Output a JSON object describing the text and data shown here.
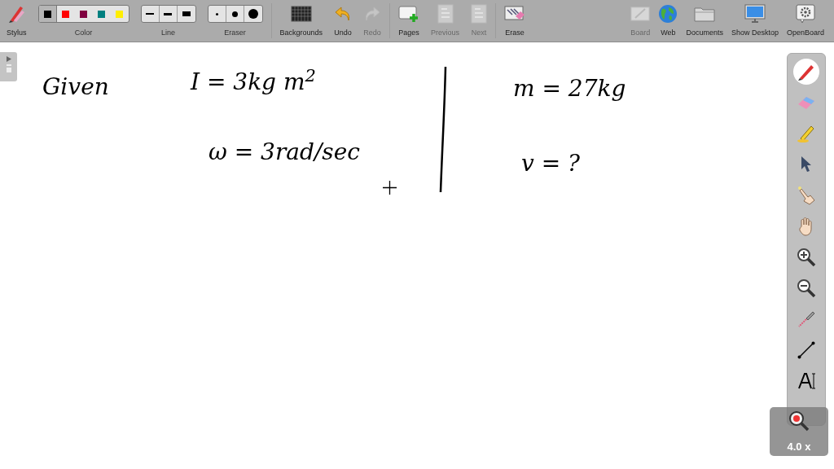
{
  "toolbar": {
    "left": [
      {
        "kind": "button",
        "label": "Stylus",
        "disabled": false
      },
      {
        "kind": "colors",
        "label": "Color",
        "swatches": [
          {
            "color": "#000000",
            "selected": true
          },
          {
            "color": "#ff0000",
            "selected": false
          },
          {
            "color": "#800040",
            "selected": false
          },
          {
            "color": "#008080",
            "selected": false
          },
          {
            "color": "#ffee00",
            "selected": false
          }
        ]
      },
      {
        "kind": "sizes",
        "label": "Line"
      },
      {
        "kind": "dots",
        "label": "Eraser"
      },
      {
        "kind": "button",
        "label": "Backgrounds",
        "disabled": false
      },
      {
        "kind": "button",
        "label": "Undo",
        "disabled": false
      },
      {
        "kind": "button",
        "label": "Redo",
        "disabled": true
      },
      {
        "kind": "button",
        "label": "Pages",
        "disabled": false
      },
      {
        "kind": "button",
        "label": "Previous",
        "disabled": true
      },
      {
        "kind": "button",
        "label": "Next",
        "disabled": true
      },
      {
        "kind": "button",
        "label": "Erase",
        "disabled": false
      }
    ],
    "right": [
      {
        "kind": "button",
        "label": "Board",
        "disabled": true
      },
      {
        "kind": "button",
        "label": "Web",
        "disabled": false
      },
      {
        "kind": "button",
        "label": "Documents",
        "disabled": false
      },
      {
        "kind": "button",
        "label": "Show Desktop",
        "disabled": false
      },
      {
        "kind": "button",
        "label": "OpenBoard",
        "disabled": false
      }
    ]
  },
  "board": {
    "notes": [
      {
        "text": "Given"
      },
      {
        "text": "I = 3kg m$^{2}$"
      },
      {
        "text": "ω = 3rad/sec"
      },
      {
        "text": "m = 27kg"
      },
      {
        "text": "v = ?"
      }
    ]
  },
  "tool_palette": {
    "tools": [
      {
        "selected": true
      },
      {
        "selected": false
      },
      {
        "selected": false
      },
      {
        "selected": false
      },
      {
        "selected": false
      },
      {
        "selected": false
      },
      {
        "selected": false
      },
      {
        "selected": false
      },
      {
        "selected": false
      },
      {
        "selected": false
      },
      {
        "selected": false
      }
    ]
  },
  "zoom_badge": "4.0 x"
}
